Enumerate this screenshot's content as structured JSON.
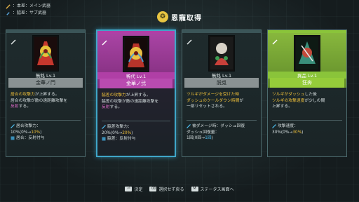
{
  "legend": {
    "main": "：本差：メイン武器",
    "sub": "：脇差：サブ武器"
  },
  "header": {
    "title": "恩寵取得"
  },
  "cards": [
    {
      "level": "無銘 Lv.1",
      "name": "金華ノ門",
      "desc": [
        [
          {
            "t": "居合の攻撃力",
            "c": "o"
          },
          {
            "t": "が上昇する。",
            "c": ""
          }
        ],
        [
          {
            "t": "居合の攻撃が敵の遠距離攻撃を",
            "c": ""
          }
        ],
        [
          {
            "t": "反射",
            "c": "p"
          },
          {
            "t": "する。",
            "c": ""
          }
        ]
      ],
      "stats": [
        {
          "icon": "sword-stat-icon",
          "parts": [
            {
              "t": "居合攻撃力：",
              "c": ""
            }
          ]
        },
        {
          "icon": "",
          "parts": [
            {
              "t": "10%(0%→",
              "c": ""
            },
            {
              "t": "10%",
              "c": "o"
            },
            {
              "t": ")",
              "c": ""
            }
          ]
        },
        {
          "icon": "reflect-stat-icon",
          "parts": [
            {
              "t": "居合：反射付与",
              "c": ""
            }
          ]
        }
      ]
    },
    {
      "level": "稀代 Lv.1",
      "name": "金華ノ弐",
      "desc": [
        [
          {
            "t": "脇差の攻撃力",
            "c": "o"
          },
          {
            "t": "が上昇する。",
            "c": ""
          }
        ],
        [
          {
            "t": "脇差の攻撃が敵の遠距離攻撃を",
            "c": ""
          }
        ],
        [
          {
            "t": "反射",
            "c": "p"
          },
          {
            "t": "する。",
            "c": ""
          }
        ]
      ],
      "stats": [
        {
          "icon": "sword-stat-icon",
          "parts": [
            {
              "t": "脇差攻撃力：",
              "c": ""
            }
          ]
        },
        {
          "icon": "",
          "parts": [
            {
              "t": "20%(0%→",
              "c": ""
            },
            {
              "t": "20%",
              "c": "o"
            },
            {
              "t": ")",
              "c": ""
            }
          ]
        },
        {
          "icon": "reflect-stat-icon",
          "parts": [
            {
              "t": "脇差：反射付与",
              "c": ""
            }
          ]
        }
      ]
    },
    {
      "level": "無銘 Lv.1",
      "name": "脱兎",
      "desc": [
        [
          {
            "t": "ツルギがダメージを受けた時",
            "c": "o"
          }
        ],
        [
          {
            "t": "ダッシュのクールダウン時間",
            "c": "o"
          },
          {
            "t": "が",
            "c": ""
          }
        ],
        [
          {
            "t": "一部リセットされる。",
            "c": ""
          }
        ]
      ],
      "stats": [
        {
          "icon": "sword-stat-icon",
          "parts": [
            {
              "t": "被ダメージ時：ダッシュ回復",
              "c": ""
            }
          ]
        },
        {
          "icon": "",
          "parts": [
            {
              "t": "ダッシュ回復量：",
              "c": ""
            }
          ]
        },
        {
          "icon": "",
          "parts": [
            {
              "t": "1回(0回→",
              "c": ""
            },
            {
              "t": "1回",
              "c": "b"
            },
            {
              "t": ")",
              "c": ""
            }
          ]
        }
      ]
    },
    {
      "level": "異品 Lv.1",
      "name": "狂奔",
      "desc": [
        [
          {
            "t": "ツルギがダッシュ",
            "c": "o"
          },
          {
            "t": "した後",
            "c": ""
          }
        ],
        [
          {
            "t": "ツルギの攻撃速度",
            "c": "o"
          },
          {
            "t": "が少しの間",
            "c": ""
          }
        ],
        [
          {
            "t": "上昇する。",
            "c": ""
          }
        ]
      ],
      "stats": [
        {
          "icon": "speed-stat-icon",
          "parts": [
            {
              "t": "攻撃速度：",
              "c": ""
            }
          ]
        },
        {
          "icon": "",
          "parts": [
            {
              "t": "30%(0%→",
              "c": ""
            },
            {
              "t": "30%",
              "c": "o"
            },
            {
              "t": ")",
              "c": ""
            }
          ]
        }
      ]
    }
  ],
  "footer": {
    "confirm": "決定",
    "skip": "選択せず戻る",
    "status": "ステータス画面へ",
    "key_confirm": "⏎",
    "key_skip": "⌫",
    "key_status": "M"
  },
  "colors": {
    "selected_border": "#3fa6c8",
    "accent_orange": "#f0c13a",
    "accent_pink": "#e86fd1",
    "accent_blue": "#4fc3f7",
    "rare_purple": "#b03fa6",
    "rare_green": "#8ac43a"
  }
}
